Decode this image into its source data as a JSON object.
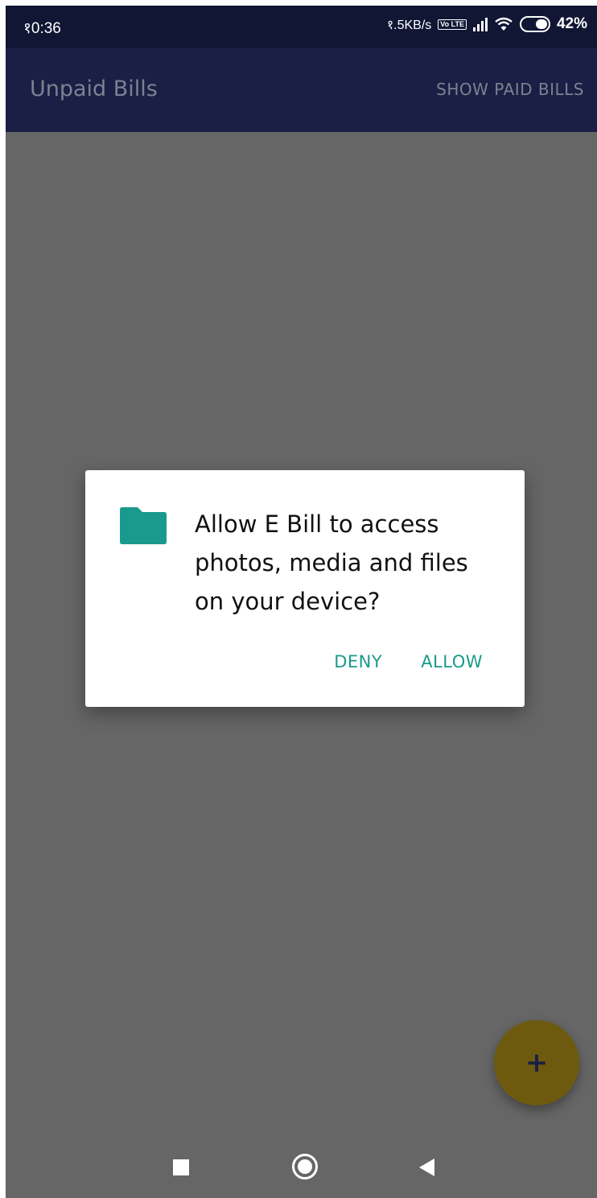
{
  "status_bar": {
    "time": "१0:36",
    "network_speed": "१.5KB/s",
    "volte_label": "Vo LTE",
    "battery_percent": "42%"
  },
  "app_bar": {
    "title": "Unpaid Bills",
    "action_label": "SHOW PAID BILLS"
  },
  "dialog": {
    "icon": "folder-icon",
    "message": "Allow E Bill to access photos, media and files on your device?",
    "deny_label": "DENY",
    "allow_label": "ALLOW"
  },
  "fab": {
    "label": "+"
  },
  "colors": {
    "status_bar": "#101634",
    "app_bar": "#1b1f45",
    "scrim": "#666666",
    "accent": "#1a9a8c",
    "fab": "#6e5a0f"
  }
}
